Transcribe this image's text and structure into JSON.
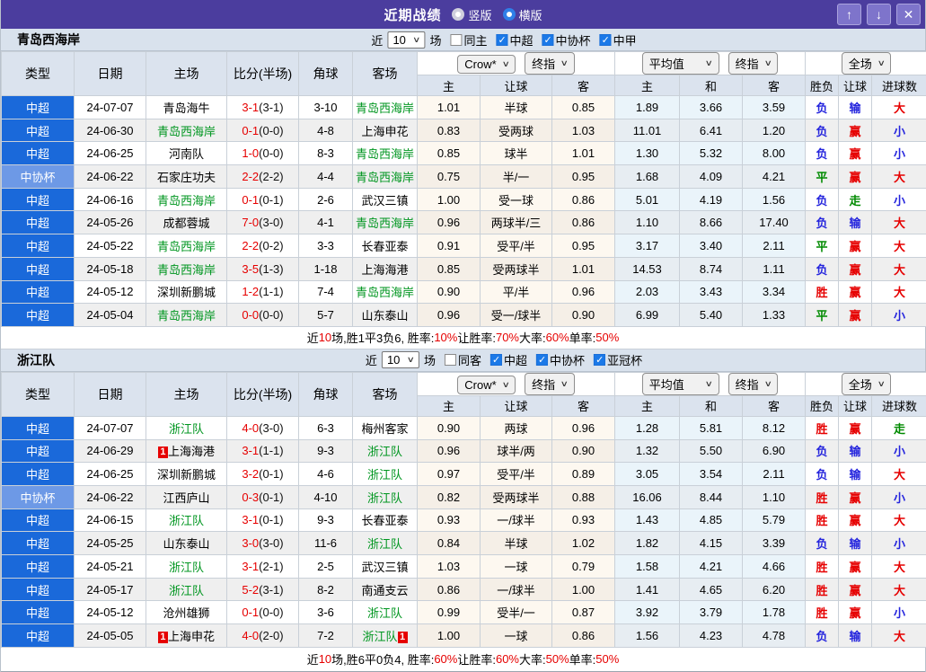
{
  "titlebar": {
    "title": "近期战绩",
    "view_options": [
      {
        "label": "竖版",
        "selected": false
      },
      {
        "label": "横版",
        "selected": true
      }
    ],
    "window_buttons": {
      "up": "↑",
      "down": "↓",
      "close": "✕"
    }
  },
  "table_header": {
    "main": [
      "类型",
      "日期",
      "主场",
      "比分(半场)",
      "角球",
      "客场"
    ],
    "sub": [
      "主",
      "让球",
      "客",
      "主",
      "和",
      "客",
      "胜负",
      "让球",
      "进球数"
    ],
    "dropdowns": [
      "Crow*",
      "终指",
      "平均值",
      "终指",
      "全场"
    ]
  },
  "colors": {
    "accent_blue": "#1a69da",
    "cup_blue": "#6d99e6",
    "win_red": "#e60000",
    "lose_blue": "#2424dd",
    "draw_green": "#008a00",
    "team_green": "#009620",
    "titlebar_purple": "#4b3d9e"
  },
  "sections": [
    {
      "team": "青岛西海岸",
      "filter": {
        "near": "近",
        "count": "10",
        "games": "场",
        "same": {
          "label": "同主",
          "checked": false
        },
        "leagues": [
          {
            "label": "中超",
            "checked": true
          },
          {
            "label": "中协杯",
            "checked": true
          },
          {
            "label": "中甲",
            "checked": true
          }
        ]
      },
      "rows": [
        {
          "league": "中超",
          "date": "24-07-07",
          "home": {
            "name": "青岛海牛"
          },
          "score": "3-1",
          "half": "(3-1)",
          "corner": "3-10",
          "away": {
            "name": "青岛西海岸",
            "self": true
          },
          "crow": [
            "1.01",
            "半球",
            "0.85"
          ],
          "avg": [
            "1.89",
            "3.66",
            "3.59"
          ],
          "result": [
            "负",
            "输",
            "大"
          ]
        },
        {
          "league": "中超",
          "date": "24-06-30",
          "home": {
            "name": "青岛西海岸",
            "self": true
          },
          "score": "0-1",
          "half": "(0-0)",
          "corner": "4-8",
          "away": {
            "name": "上海申花"
          },
          "crow": [
            "0.83",
            "受两球",
            "1.03"
          ],
          "avg": [
            "11.01",
            "6.41",
            "1.20"
          ],
          "result": [
            "负",
            "赢",
            "小"
          ]
        },
        {
          "league": "中超",
          "date": "24-06-25",
          "home": {
            "name": "河南队"
          },
          "score": "1-0",
          "half": "(0-0)",
          "corner": "8-3",
          "away": {
            "name": "青岛西海岸",
            "self": true
          },
          "crow": [
            "0.85",
            "球半",
            "1.01"
          ],
          "avg": [
            "1.30",
            "5.32",
            "8.00"
          ],
          "result": [
            "负",
            "赢",
            "小"
          ]
        },
        {
          "league": "中协杯",
          "date": "24-06-22",
          "home": {
            "name": "石家庄功夫"
          },
          "score": "2-2",
          "half": "(2-2)",
          "corner": "4-4",
          "away": {
            "name": "青岛西海岸",
            "self": true
          },
          "crow": [
            "0.75",
            "半/一",
            "0.95"
          ],
          "avg": [
            "1.68",
            "4.09",
            "4.21"
          ],
          "result": [
            "平",
            "赢",
            "大"
          ]
        },
        {
          "league": "中超",
          "date": "24-06-16",
          "home": {
            "name": "青岛西海岸",
            "self": true
          },
          "score": "0-1",
          "half": "(0-1)",
          "corner": "2-6",
          "away": {
            "name": "武汉三镇"
          },
          "crow": [
            "1.00",
            "受一球",
            "0.86"
          ],
          "avg": [
            "5.01",
            "4.19",
            "1.56"
          ],
          "result": [
            "负",
            "走",
            "小"
          ]
        },
        {
          "league": "中超",
          "date": "24-05-26",
          "home": {
            "name": "成都蓉城"
          },
          "score": "7-0",
          "half": "(3-0)",
          "corner": "4-1",
          "away": {
            "name": "青岛西海岸",
            "self": true
          },
          "crow": [
            "0.96",
            "两球半/三",
            "0.86"
          ],
          "avg": [
            "1.10",
            "8.66",
            "17.40"
          ],
          "result": [
            "负",
            "输",
            "大"
          ]
        },
        {
          "league": "中超",
          "date": "24-05-22",
          "home": {
            "name": "青岛西海岸",
            "self": true
          },
          "score": "2-2",
          "half": "(0-2)",
          "corner": "3-3",
          "away": {
            "name": "长春亚泰"
          },
          "crow": [
            "0.91",
            "受平/半",
            "0.95"
          ],
          "avg": [
            "3.17",
            "3.40",
            "2.11"
          ],
          "result": [
            "平",
            "赢",
            "大"
          ]
        },
        {
          "league": "中超",
          "date": "24-05-18",
          "home": {
            "name": "青岛西海岸",
            "self": true
          },
          "score": "3-5",
          "half": "(1-3)",
          "corner": "1-18",
          "away": {
            "name": "上海海港"
          },
          "crow": [
            "0.85",
            "受两球半",
            "1.01"
          ],
          "avg": [
            "14.53",
            "8.74",
            "1.11"
          ],
          "result": [
            "负",
            "赢",
            "大"
          ]
        },
        {
          "league": "中超",
          "date": "24-05-12",
          "home": {
            "name": "深圳新鹏城"
          },
          "score": "1-2",
          "half": "(1-1)",
          "corner": "7-4",
          "away": {
            "name": "青岛西海岸",
            "self": true
          },
          "crow": [
            "0.90",
            "平/半",
            "0.96"
          ],
          "avg": [
            "2.03",
            "3.43",
            "3.34"
          ],
          "result": [
            "胜",
            "赢",
            "大"
          ]
        },
        {
          "league": "中超",
          "date": "24-05-04",
          "home": {
            "name": "青岛西海岸",
            "self": true
          },
          "score": "0-0",
          "half": "(0-0)",
          "corner": "5-7",
          "away": {
            "name": "山东泰山"
          },
          "crow": [
            "0.96",
            "受一/球半",
            "0.90"
          ],
          "avg": [
            "6.99",
            "5.40",
            "1.33"
          ],
          "result": [
            "平",
            "赢",
            "小"
          ]
        }
      ],
      "summary": [
        {
          "t": "近"
        },
        {
          "t": "10",
          "red": true
        },
        {
          "t": "场,胜1平3负6, 胜率:"
        },
        {
          "t": "10%",
          "red": true
        },
        {
          "t": " 让胜率:"
        },
        {
          "t": "70%",
          "red": true
        },
        {
          "t": " 大率:"
        },
        {
          "t": "60%",
          "red": true
        },
        {
          "t": " 单率:"
        },
        {
          "t": "50%",
          "red": true
        }
      ]
    },
    {
      "team": "浙江队",
      "filter": {
        "near": "近",
        "count": "10",
        "games": "场",
        "same": {
          "label": "同客",
          "checked": false
        },
        "leagues": [
          {
            "label": "中超",
            "checked": true
          },
          {
            "label": "中协杯",
            "checked": true
          },
          {
            "label": "亚冠杯",
            "checked": true
          }
        ]
      },
      "rows": [
        {
          "league": "中超",
          "date": "24-07-07",
          "home": {
            "name": "浙江队",
            "self": true
          },
          "score": "4-0",
          "half": "(3-0)",
          "corner": "6-3",
          "away": {
            "name": "梅州客家"
          },
          "crow": [
            "0.90",
            "两球",
            "0.96"
          ],
          "avg": [
            "1.28",
            "5.81",
            "8.12"
          ],
          "result": [
            "胜",
            "赢",
            "走"
          ]
        },
        {
          "league": "中超",
          "date": "24-06-29",
          "home": {
            "name": "上海海港",
            "badge": "1"
          },
          "score": "3-1",
          "half": "(1-1)",
          "corner": "9-3",
          "away": {
            "name": "浙江队",
            "self": true
          },
          "crow": [
            "0.96",
            "球半/两",
            "0.90"
          ],
          "avg": [
            "1.32",
            "5.50",
            "6.90"
          ],
          "result": [
            "负",
            "输",
            "小"
          ]
        },
        {
          "league": "中超",
          "date": "24-06-25",
          "home": {
            "name": "深圳新鹏城"
          },
          "score": "3-2",
          "half": "(0-1)",
          "corner": "4-6",
          "away": {
            "name": "浙江队",
            "self": true
          },
          "crow": [
            "0.97",
            "受平/半",
            "0.89"
          ],
          "avg": [
            "3.05",
            "3.54",
            "2.11"
          ],
          "result": [
            "负",
            "输",
            "大"
          ]
        },
        {
          "league": "中协杯",
          "date": "24-06-22",
          "home": {
            "name": "江西庐山"
          },
          "score": "0-3",
          "half": "(0-1)",
          "corner": "4-10",
          "away": {
            "name": "浙江队",
            "self": true
          },
          "crow": [
            "0.82",
            "受两球半",
            "0.88"
          ],
          "avg": [
            "16.06",
            "8.44",
            "1.10"
          ],
          "result": [
            "胜",
            "赢",
            "小"
          ]
        },
        {
          "league": "中超",
          "date": "24-06-15",
          "home": {
            "name": "浙江队",
            "self": true
          },
          "score": "3-1",
          "half": "(0-1)",
          "corner": "9-3",
          "away": {
            "name": "长春亚泰"
          },
          "crow": [
            "0.93",
            "一/球半",
            "0.93"
          ],
          "avg": [
            "1.43",
            "4.85",
            "5.79"
          ],
          "result": [
            "胜",
            "赢",
            "大"
          ]
        },
        {
          "league": "中超",
          "date": "24-05-25",
          "home": {
            "name": "山东泰山"
          },
          "score": "3-0",
          "half": "(3-0)",
          "corner": "11-6",
          "away": {
            "name": "浙江队",
            "self": true
          },
          "crow": [
            "0.84",
            "半球",
            "1.02"
          ],
          "avg": [
            "1.82",
            "4.15",
            "3.39"
          ],
          "result": [
            "负",
            "输",
            "小"
          ]
        },
        {
          "league": "中超",
          "date": "24-05-21",
          "home": {
            "name": "浙江队",
            "self": true
          },
          "score": "3-1",
          "half": "(2-1)",
          "corner": "2-5",
          "away": {
            "name": "武汉三镇"
          },
          "crow": [
            "1.03",
            "一球",
            "0.79"
          ],
          "avg": [
            "1.58",
            "4.21",
            "4.66"
          ],
          "result": [
            "胜",
            "赢",
            "大"
          ]
        },
        {
          "league": "中超",
          "date": "24-05-17",
          "home": {
            "name": "浙江队",
            "self": true
          },
          "score": "5-2",
          "half": "(3-1)",
          "corner": "8-2",
          "away": {
            "name": "南通支云"
          },
          "crow": [
            "0.86",
            "一/球半",
            "1.00"
          ],
          "avg": [
            "1.41",
            "4.65",
            "6.20"
          ],
          "result": [
            "胜",
            "赢",
            "大"
          ]
        },
        {
          "league": "中超",
          "date": "24-05-12",
          "home": {
            "name": "沧州雄狮"
          },
          "score": "0-1",
          "half": "(0-0)",
          "corner": "3-6",
          "away": {
            "name": "浙江队",
            "self": true
          },
          "crow": [
            "0.99",
            "受半/一",
            "0.87"
          ],
          "avg": [
            "3.92",
            "3.79",
            "1.78"
          ],
          "result": [
            "胜",
            "赢",
            "小"
          ]
        },
        {
          "league": "中超",
          "date": "24-05-05",
          "home": {
            "name": "上海申花",
            "badge": "1"
          },
          "score": "4-0",
          "half": "(2-0)",
          "corner": "7-2",
          "away": {
            "name": "浙江队",
            "self": true,
            "badge_after": "1"
          },
          "crow": [
            "1.00",
            "一球",
            "0.86"
          ],
          "avg": [
            "1.56",
            "4.23",
            "4.78"
          ],
          "result": [
            "负",
            "输",
            "大"
          ]
        }
      ],
      "summary": [
        {
          "t": "近"
        },
        {
          "t": "10",
          "red": true
        },
        {
          "t": "场,胜6平0负4, 胜率:"
        },
        {
          "t": "60%",
          "red": true
        },
        {
          "t": " 让胜率:"
        },
        {
          "t": "60%",
          "red": true
        },
        {
          "t": " 大率:"
        },
        {
          "t": "50%",
          "red": true
        },
        {
          "t": " 单率:"
        },
        {
          "t": "50%",
          "red": true
        }
      ]
    }
  ]
}
